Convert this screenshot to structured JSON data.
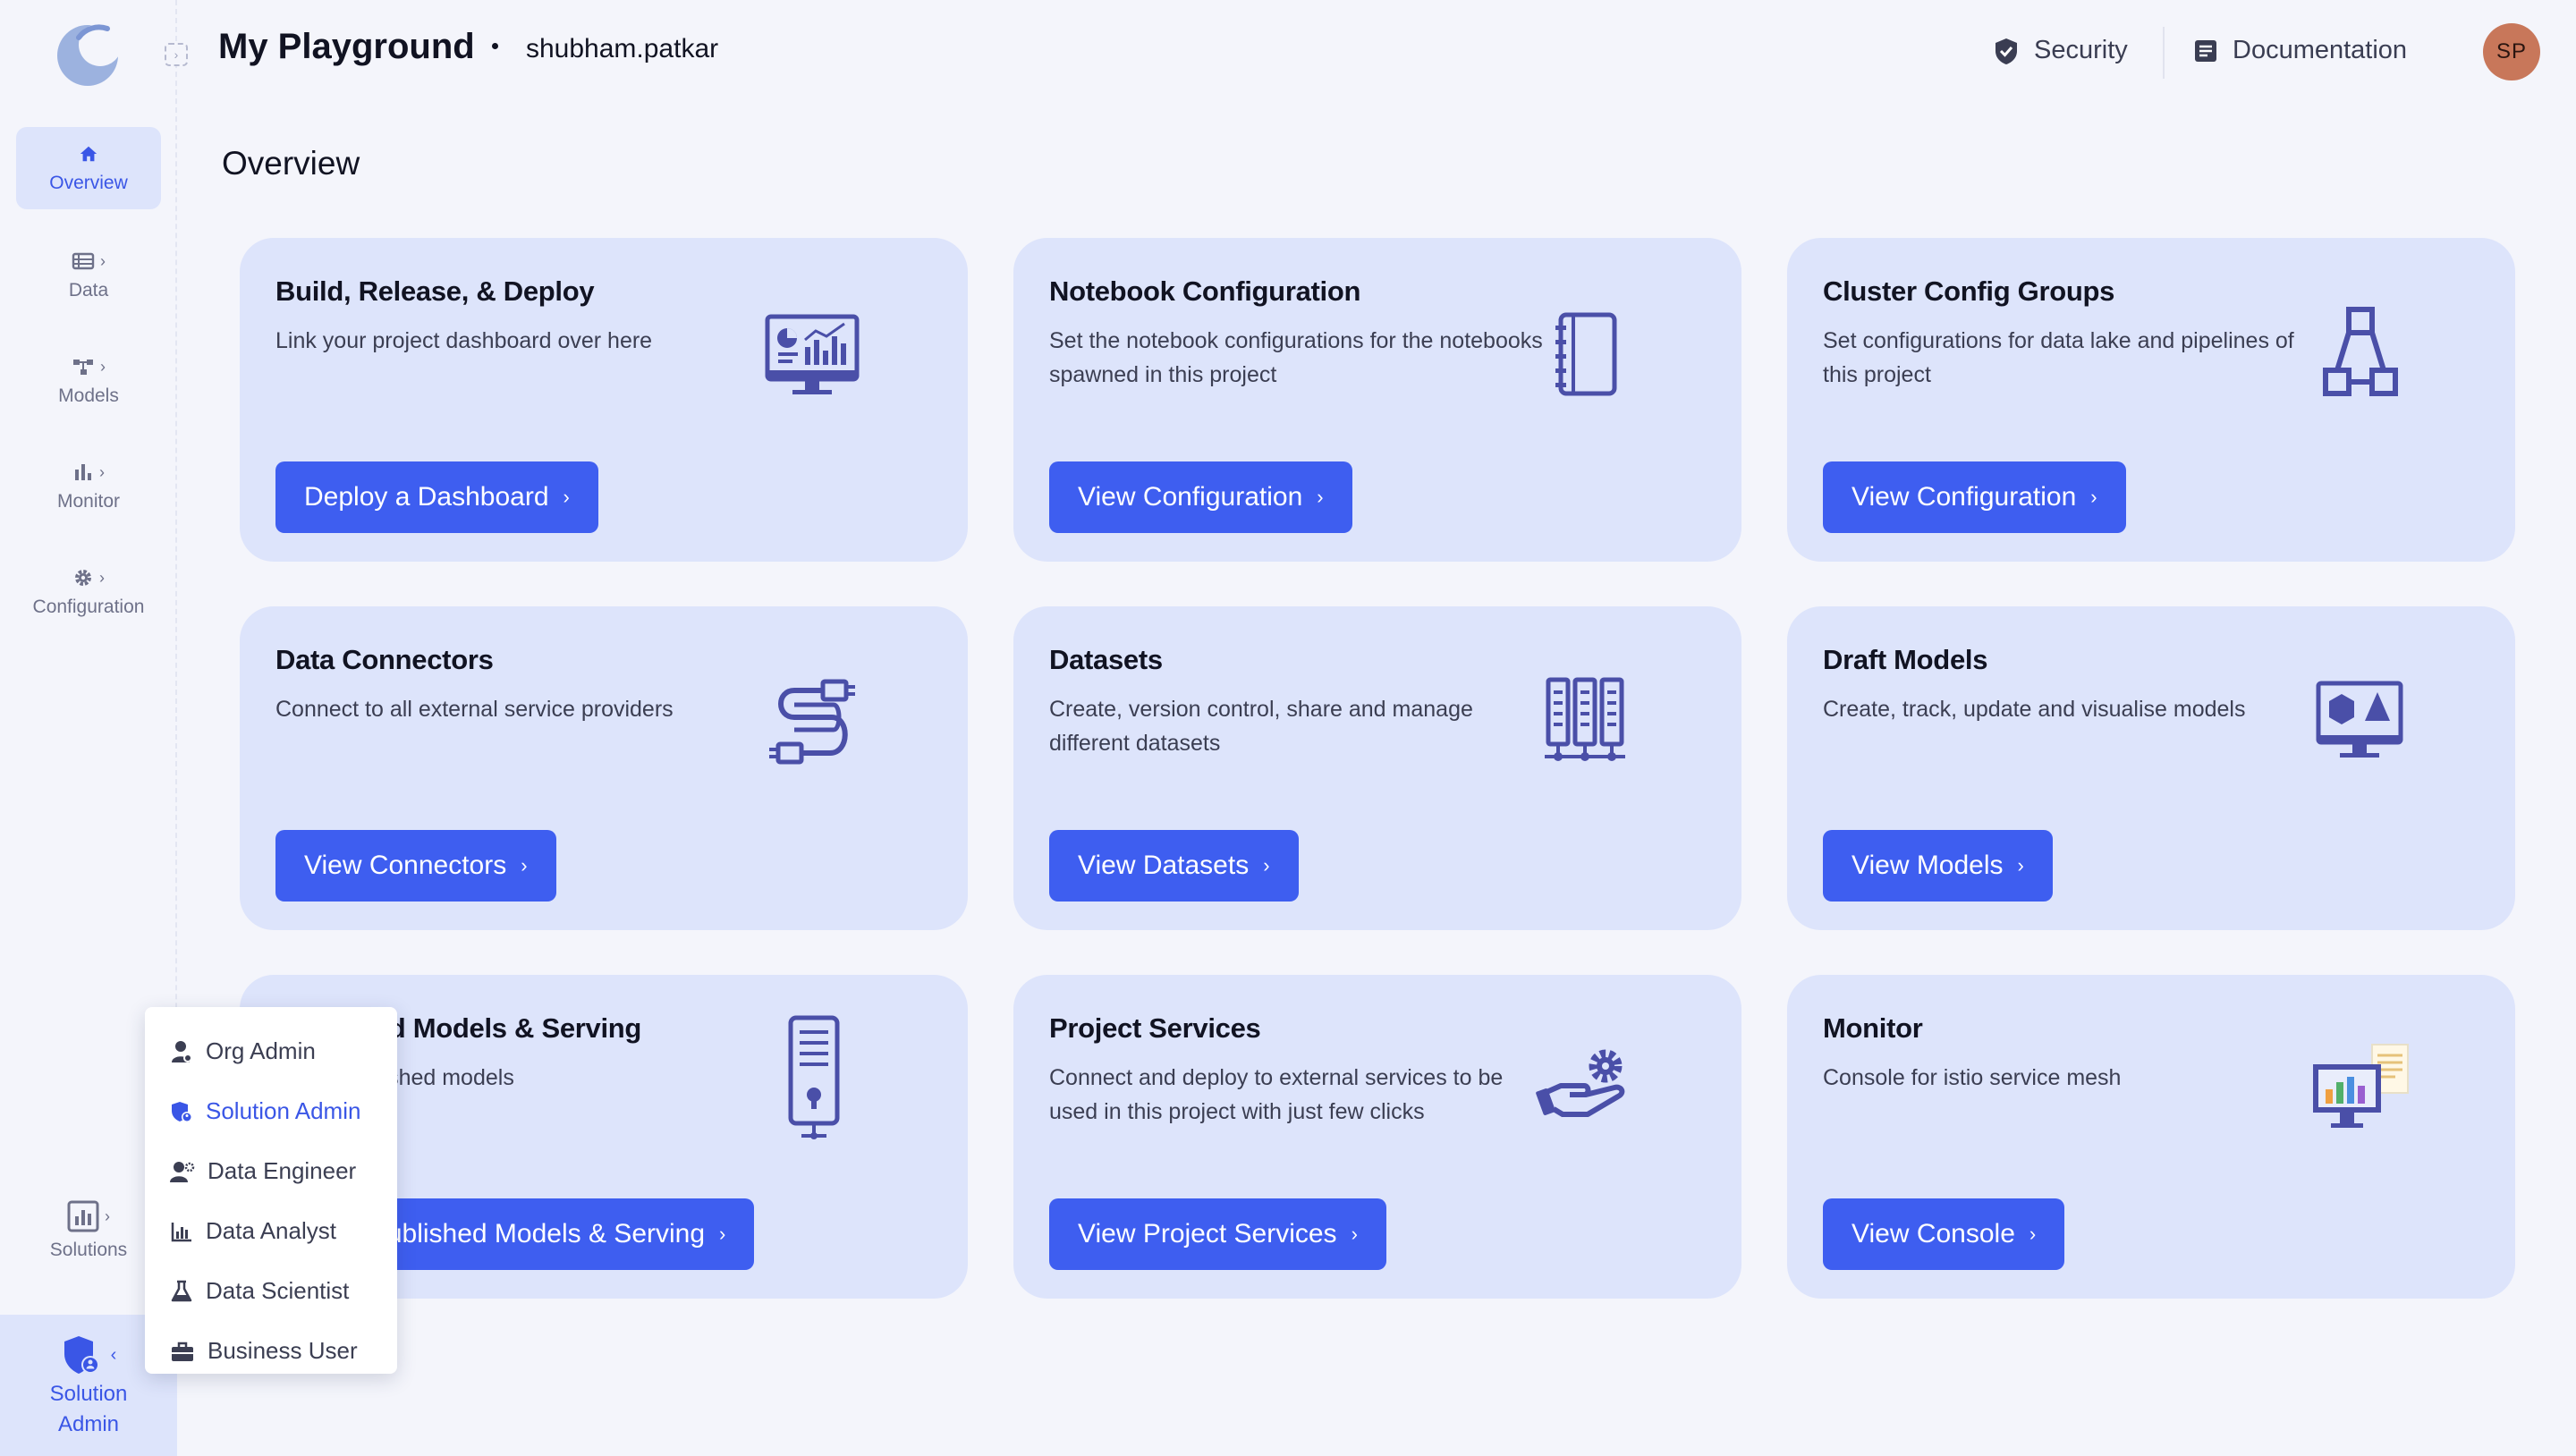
{
  "header": {
    "title": "My Playground",
    "user": "shubham.patkar",
    "security": "Security",
    "documentation": "Documentation",
    "avatar_initials": "SP"
  },
  "sidebar": {
    "items": [
      {
        "label": "Overview",
        "icon": "home-icon"
      },
      {
        "label": "Data",
        "icon": "data-icon"
      },
      {
        "label": "Models",
        "icon": "models-icon"
      },
      {
        "label": "Monitor",
        "icon": "monitor-icon"
      },
      {
        "label": "Configuration",
        "icon": "gear-icon"
      }
    ],
    "solutions": "Solutions",
    "role_line1": "Solution",
    "role_line2": "Admin"
  },
  "main": {
    "title": "Overview",
    "cards": [
      {
        "title": "Build, Release, & Deploy",
        "desc": "Link your project dashboard over here",
        "button": "Deploy a Dashboard",
        "icon": "dashboard-monitor-icon"
      },
      {
        "title": "Notebook Configuration",
        "desc": "Set the notebook configurations for the notebooks spawned in this project",
        "button": "View Configuration",
        "icon": "notebook-icon"
      },
      {
        "title": "Cluster Config Groups",
        "desc": "Set configurations for data lake and pipelines of this project",
        "button": "View Configuration",
        "icon": "hierarchy-icon"
      },
      {
        "title": "Data Connectors",
        "desc": "Connect to all external service providers",
        "button": "View Connectors",
        "icon": "cable-icon"
      },
      {
        "title": "Datasets",
        "desc": "Create, version control, share and manage different datasets",
        "button": "View Datasets",
        "icon": "servers-icon"
      },
      {
        "title": "Draft Models",
        "desc": "Create, track, update and visualise models",
        "button": "View Models",
        "icon": "model-screen-icon"
      },
      {
        "title": "Published Models & Serving",
        "desc": "Serve published models",
        "button": "View Published Models & Serving",
        "icon": "server-tower-icon"
      },
      {
        "title": "Project Services",
        "desc": "Connect and deploy to external services to be used in this project with just few clicks",
        "button": "View Project Services",
        "icon": "hand-gear-icon"
      },
      {
        "title": "Monitor",
        "desc": "Console for istio service mesh",
        "button": "View Console",
        "icon": "console-icon"
      }
    ]
  },
  "role_menu": {
    "items": [
      {
        "label": "Org Admin",
        "icon": "org-admin-icon"
      },
      {
        "label": "Solution Admin",
        "icon": "solution-admin-icon",
        "selected": true
      },
      {
        "label": "Data Engineer",
        "icon": "data-engineer-icon"
      },
      {
        "label": "Data Analyst",
        "icon": "data-analyst-icon"
      },
      {
        "label": "Data Scientist",
        "icon": "flask-icon"
      },
      {
        "label": "Business User",
        "icon": "briefcase-icon"
      }
    ]
  },
  "colors": {
    "accent": "#3e5ef0",
    "card_bg": "#dde4fb",
    "icon": "#4a4fa8",
    "page_bg": "#f4f5fb"
  }
}
